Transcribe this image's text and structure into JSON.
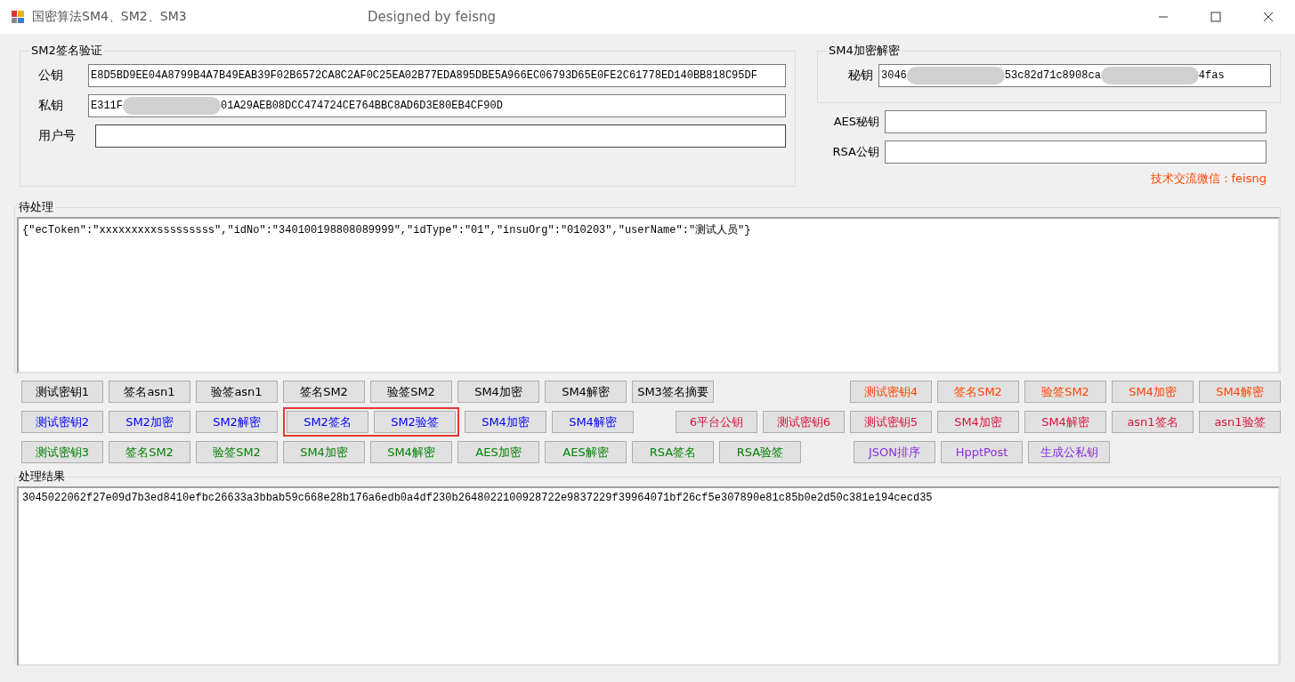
{
  "window": {
    "title": "国密算法SM4、SM2、SM3",
    "subtitle": "Designed by feisng"
  },
  "sm2_group": {
    "title": "SM2签名验证",
    "fields": [
      {
        "label": "公钥",
        "value": "E8D5BD9EE04A8799B4A7B49EAB39F02B6572CA8C2AF0C25EA02B77EDA895DBE5A966EC06793D65E0FE2C61778ED140BB818C95DF",
        "blurred": false
      },
      {
        "label": "私钥",
        "value": "E311F",
        "value_after_blur": "01A29AEB08DCC474724CE764BBC8AD6D3E80EB4CF90D",
        "blurred": true
      },
      {
        "label": "用户号",
        "blurred": false
      }
    ]
  },
  "sm4_group": {
    "title": "SM4加密解密",
    "fields": [
      {
        "label": "秘钥",
        "value": "3046",
        "value_middle": "53c82d71c8908ca",
        "value_after_blur": "4fas",
        "blurred": true
      }
    ]
  },
  "extra_fields": [
    {
      "label": "AES秘钥"
    },
    {
      "label": "RSA公钥"
    }
  ],
  "contact": "技术交流微信：feisng",
  "input_group": {
    "title": "待处理",
    "text": "{\"ecToken\":\"xxxxxxxxxsssssssss\",\"idNo\":\"340100198808089999\",\"idType\":\"01\",\"insuOrg\":\"010203\",\"userName\":\"测试人员\"}"
  },
  "button_rows": [
    {
      "left": {
        "color": "#000000",
        "buttons": [
          {
            "label": "测试密钥1",
            "highlighted": false
          },
          {
            "label": "签名asn1",
            "highlighted": false
          },
          {
            "label": "验签asn1",
            "highlighted": false
          },
          {
            "label": "签名SM2",
            "highlighted": false
          },
          {
            "label": "验签SM2",
            "highlighted": false
          },
          {
            "label": "SM4加密",
            "highlighted": false
          },
          {
            "label": "SM4解密",
            "highlighted": false
          },
          {
            "label": "SM3签名摘要",
            "highlighted": false
          }
        ]
      },
      "right": {
        "color": "#ff4500",
        "buttons": [
          {
            "label": "测试密钥4"
          },
          {
            "label": "签名SM2"
          },
          {
            "label": "验签SM2"
          },
          {
            "label": "SM4加密"
          },
          {
            "label": "SM4解密"
          }
        ]
      }
    },
    {
      "left": {
        "color": "#0000ff",
        "buttons": [
          {
            "label": "测试密钥2",
            "highlighted": false
          },
          {
            "label": "SM2加密",
            "highlighted": false
          },
          {
            "label": "SM2解密",
            "highlighted": false
          },
          {
            "label": "SM2签名",
            "highlighted": true
          },
          {
            "label": "SM2验签",
            "highlighted": true
          },
          {
            "label": "SM4加密",
            "highlighted": false
          },
          {
            "label": "SM4解密",
            "highlighted": false
          }
        ]
      },
      "right": {
        "color": "#dc143c",
        "buttons": [
          {
            "label": "6平台公钥"
          },
          {
            "label": "测试密钥6"
          },
          {
            "label": "测试密钥5"
          },
          {
            "label": "SM4加密"
          },
          {
            "label": "SM4解密"
          },
          {
            "label": "asn1签名"
          },
          {
            "label": "asn1验签"
          }
        ]
      }
    },
    {
      "left": {
        "color": "#008000",
        "buttons": [
          {
            "label": "测试密钥3",
            "highlighted": false
          },
          {
            "label": "签名SM2",
            "highlighted": false
          },
          {
            "label": "验签SM2",
            "highlighted": false
          },
          {
            "label": "SM4加密",
            "highlighted": false
          },
          {
            "label": "SM4解密",
            "highlighted": false
          },
          {
            "label": "AES加密",
            "highlighted": false
          },
          {
            "label": "AES解密",
            "highlighted": false
          },
          {
            "label": "RSA签名",
            "highlighted": false
          },
          {
            "label": "RSA验签",
            "highlighted": false
          }
        ]
      },
      "right": {
        "color": "#8a2be2",
        "buttons": [
          {
            "label": "JSON排序"
          },
          {
            "label": "HpptPost"
          },
          {
            "label": "生成公私钥"
          }
        ]
      }
    }
  ],
  "result_group": {
    "title": "处理结果",
    "text": "3045022062f27e09d7b3ed8410efbc26633a3bbab59c668e28b176a6edb0a4df230b2648022100928722e9837229f39964071bf26cf5e307890e81c85b0e2d50c381e194cecd35"
  }
}
